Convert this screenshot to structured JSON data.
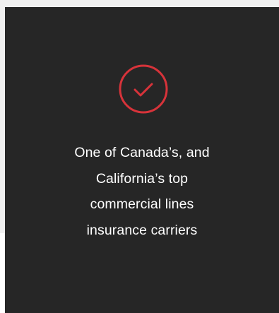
{
  "feature_card": {
    "icon": "check-circle-icon",
    "accent_color": "#d7333a",
    "lines": [
      "One of Canada’s, and",
      "California’s top",
      "commercial lines",
      "insurance carriers"
    ]
  }
}
